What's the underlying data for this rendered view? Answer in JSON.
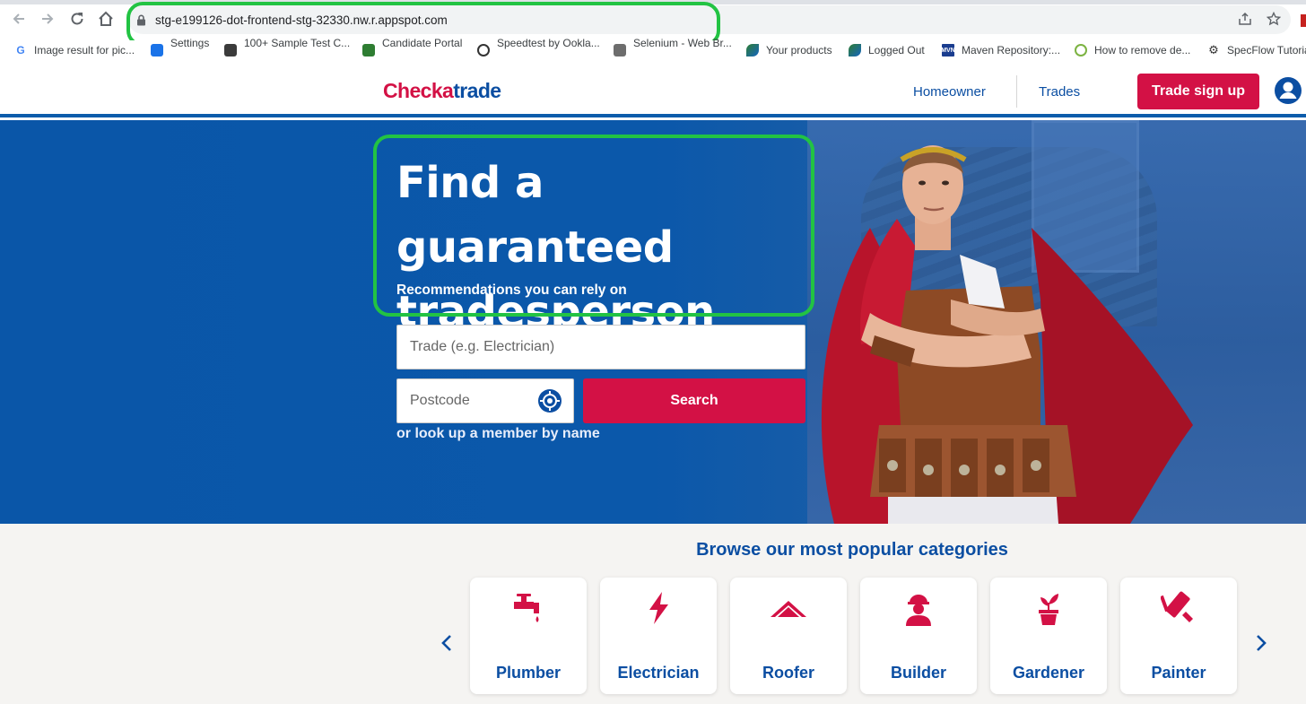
{
  "browser": {
    "url": "stg-e199126-dot-frontend-stg-32330.nw.r.appspot.com",
    "bookmarks": [
      {
        "label": "Image result for pic...",
        "icon": "google-icon"
      },
      {
        "label": "Settings",
        "icon": "settings-puzzle-icon"
      },
      {
        "label": "100+ Sample Test C...",
        "icon": "sample-test-icon"
      },
      {
        "label": "Candidate Portal",
        "icon": "candidate-portal-icon"
      },
      {
        "label": "Speedtest by Ookla...",
        "icon": "speedtest-icon"
      },
      {
        "label": "Selenium - Web Br...",
        "icon": "selenium-icon"
      },
      {
        "label": "Your products",
        "icon": "products-icon"
      },
      {
        "label": "Logged Out",
        "icon": "logged-out-icon"
      },
      {
        "label": "Maven Repository:...",
        "icon": "maven-icon"
      },
      {
        "label": "How to remove de...",
        "icon": "how-to-icon"
      },
      {
        "label": "SpecFlow Tutorial",
        "icon": "specflow-icon"
      }
    ]
  },
  "header": {
    "logo_part1": "Checka",
    "logo_part2": "trade",
    "nav": [
      "Homeowner",
      "Trades"
    ],
    "signup_label": "Trade sign up"
  },
  "hero": {
    "title": "Find a guaranteed tradesperson",
    "subtitle": "Recommendations you can rely on",
    "trade_placeholder": "Trade (e.g. Electrician)",
    "postcode_placeholder": "Postcode",
    "search_label": "Search",
    "lookup_link": "or look up a member by name"
  },
  "categories": {
    "title": "Browse our most popular categories",
    "items": [
      {
        "label": "Plumber",
        "icon": "tap-icon"
      },
      {
        "label": "Electrician",
        "icon": "lightning-icon"
      },
      {
        "label": "Roofer",
        "icon": "roof-icon"
      },
      {
        "label": "Builder",
        "icon": "builder-icon"
      },
      {
        "label": "Gardener",
        "icon": "plant-icon"
      },
      {
        "label": "Painter",
        "icon": "paint-roller-icon"
      }
    ]
  },
  "colors": {
    "brand_red": "#d31145",
    "brand_blue": "#0b4ea2",
    "highlight_green": "#22c343"
  }
}
